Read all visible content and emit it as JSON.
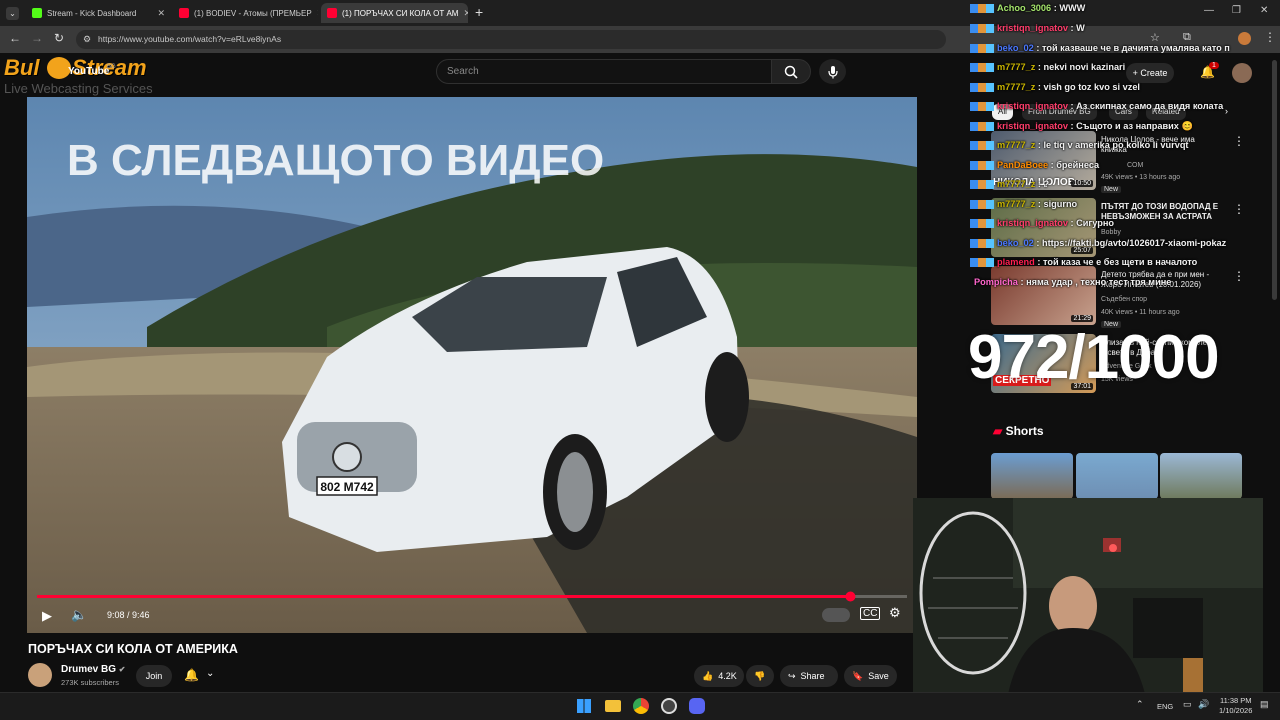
{
  "browser": {
    "tabs": [
      {
        "label": "Stream - Kick Dashboard",
        "color": "#53fc18",
        "active": false
      },
      {
        "label": "(1) BODIEV - Атомы (ПРЕМЬЕР",
        "color": "#ff0033",
        "active": false
      },
      {
        "label": "(1) ПОРЪЧАХ СИ КОЛА ОТ АМ",
        "color": "#ff0033",
        "active": true
      }
    ],
    "url": "https://www.youtube.com/watch?v=eRLve8iynAs"
  },
  "youtube": {
    "logo_overlay": {
      "title": "Bul",
      "title2": "Stream",
      "tagline": "Live Webcasting Services",
      "yt": "YouTube",
      "yt_suffix": "BG"
    },
    "search_placeholder": "Search",
    "create_label": "Create",
    "notif_count": "1",
    "video": {
      "overlay_text": "В СЛЕДВАЩОТО ВИДЕО",
      "plate": "802 M742",
      "time": "9:08 / 9:46",
      "progress": 0.935
    },
    "title": "ПОРЪЧАХ СИ КОЛА ОТ АМЕРИКА",
    "channel": "Drumev BG",
    "subscribers": "273K subscribers",
    "join_label": "Join",
    "likes": "4.2K",
    "share_label": "Share",
    "save_label": "Save"
  },
  "sidebar": {
    "chips": [
      "All",
      "From Drumev BG",
      "Cars",
      "Related"
    ],
    "videos": [
      {
        "title": "Никола Цолов - вече има книжка",
        "channel": "COM",
        "meta": "49K views • 13 hours ago",
        "badge": "New",
        "thumb_text": "НИКОЛА ЦОЛОВ",
        "duration": "10:50"
      },
      {
        "title": "ПЪТЯТ ДО ТОЗИ ВОДОПАД Е НЕВЪЗМОЖЕН ЗА АСТРАТА",
        "channel": "Bobby",
        "meta": "",
        "badge": "",
        "thumb_text": "",
        "duration": "25:07"
      },
      {
        "title": "Детето трябва да е при мен - Жоро Игнатев (10.01.2026)",
        "channel": "Съдебен спор",
        "meta": "40K views • 11 hours ago",
        "badge": "New",
        "thumb_text": "",
        "duration": "21:29"
      },
      {
        "title": "Влизах в най-скъпия комплекс в света в Дубай",
        "channel": "Adventure Geek",
        "meta": "15K views",
        "badge": "",
        "thumb_text": "СЕКРЕТНО",
        "duration": "37:01"
      }
    ],
    "shorts_label": "Shorts"
  },
  "chat": {
    "messages": [
      {
        "user": "Achoo_3006",
        "text": "WWW",
        "color": "#a4e36b"
      },
      {
        "user": "kristiqn_ignatov",
        "text": "W",
        "color": "#ff3d6b"
      },
      {
        "user": "beko_02",
        "text": "той казваше че в дачията умалява като п",
        "color": "#4a78ff"
      },
      {
        "user": "m7777_z",
        "text": "nekvi novi kazinari",
        "color": "#c8b400"
      },
      {
        "user": "m7777_z",
        "text": "vish go toz kvo si vzel",
        "color": "#c8b400"
      },
      {
        "user": "kristiqn_ignatov",
        "text": "Аз скипнах само да видя колата",
        "color": "#ff3d6b"
      },
      {
        "user": "kristiqn_ignatov",
        "text": "Същото и аз направих 😊",
        "color": "#ff3d6b"
      },
      {
        "user": "m7777_z",
        "text": "le tiq v amerika po kolko li vurvqt",
        "color": "#c8b400"
      },
      {
        "user": "PanDaBoee",
        "text": "брейнеса",
        "color": "#ff8c00"
      },
      {
        "user": "m7777_z",
        "text": "?",
        "color": "#c8b400"
      },
      {
        "user": "m7777_z",
        "text": "sigurno",
        "color": "#c8b400"
      },
      {
        "user": "kristiqn_ignatov",
        "text": "Сигурно",
        "color": "#ff3d6b"
      },
      {
        "user": "beko_02",
        "text": "https://fakti.bg/avto/1026017-xiaomi-pokaz",
        "color": "#4a78ff"
      },
      {
        "user": "plamend",
        "text": "той каза че е без щети в началото",
        "color": "#ff1f50"
      },
      {
        "user": "Pompicha",
        "text": "няма удар , техно тест тря мине",
        "color": "#ff66cc"
      }
    ]
  },
  "counter": "972/1000",
  "taskbar": {
    "lang": "ENG",
    "time": "11:38 PM",
    "date": "1/10/2026"
  }
}
